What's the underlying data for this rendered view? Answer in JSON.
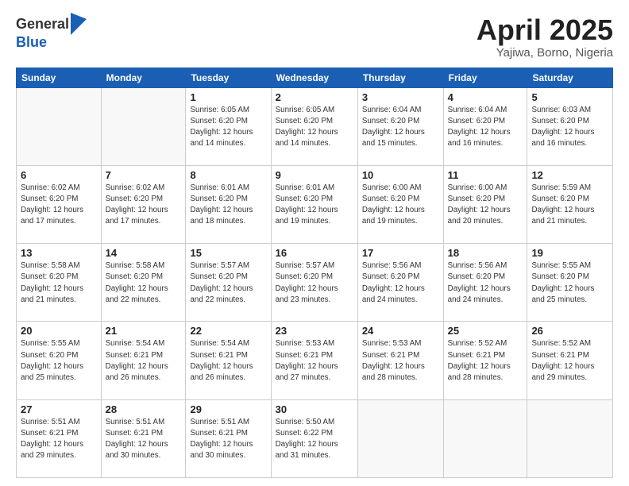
{
  "header": {
    "logo_general": "General",
    "logo_blue": "Blue",
    "title": "April 2025",
    "subtitle": "Yajiwa, Borno, Nigeria"
  },
  "weekdays": [
    "Sunday",
    "Monday",
    "Tuesday",
    "Wednesday",
    "Thursday",
    "Friday",
    "Saturday"
  ],
  "weeks": [
    [
      {
        "day": "",
        "info": ""
      },
      {
        "day": "",
        "info": ""
      },
      {
        "day": "1",
        "info": "Sunrise: 6:05 AM\nSunset: 6:20 PM\nDaylight: 12 hours\nand 14 minutes."
      },
      {
        "day": "2",
        "info": "Sunrise: 6:05 AM\nSunset: 6:20 PM\nDaylight: 12 hours\nand 14 minutes."
      },
      {
        "day": "3",
        "info": "Sunrise: 6:04 AM\nSunset: 6:20 PM\nDaylight: 12 hours\nand 15 minutes."
      },
      {
        "day": "4",
        "info": "Sunrise: 6:04 AM\nSunset: 6:20 PM\nDaylight: 12 hours\nand 16 minutes."
      },
      {
        "day": "5",
        "info": "Sunrise: 6:03 AM\nSunset: 6:20 PM\nDaylight: 12 hours\nand 16 minutes."
      }
    ],
    [
      {
        "day": "6",
        "info": "Sunrise: 6:02 AM\nSunset: 6:20 PM\nDaylight: 12 hours\nand 17 minutes."
      },
      {
        "day": "7",
        "info": "Sunrise: 6:02 AM\nSunset: 6:20 PM\nDaylight: 12 hours\nand 17 minutes."
      },
      {
        "day": "8",
        "info": "Sunrise: 6:01 AM\nSunset: 6:20 PM\nDaylight: 12 hours\nand 18 minutes."
      },
      {
        "day": "9",
        "info": "Sunrise: 6:01 AM\nSunset: 6:20 PM\nDaylight: 12 hours\nand 19 minutes."
      },
      {
        "day": "10",
        "info": "Sunrise: 6:00 AM\nSunset: 6:20 PM\nDaylight: 12 hours\nand 19 minutes."
      },
      {
        "day": "11",
        "info": "Sunrise: 6:00 AM\nSunset: 6:20 PM\nDaylight: 12 hours\nand 20 minutes."
      },
      {
        "day": "12",
        "info": "Sunrise: 5:59 AM\nSunset: 6:20 PM\nDaylight: 12 hours\nand 21 minutes."
      }
    ],
    [
      {
        "day": "13",
        "info": "Sunrise: 5:58 AM\nSunset: 6:20 PM\nDaylight: 12 hours\nand 21 minutes."
      },
      {
        "day": "14",
        "info": "Sunrise: 5:58 AM\nSunset: 6:20 PM\nDaylight: 12 hours\nand 22 minutes."
      },
      {
        "day": "15",
        "info": "Sunrise: 5:57 AM\nSunset: 6:20 PM\nDaylight: 12 hours\nand 22 minutes."
      },
      {
        "day": "16",
        "info": "Sunrise: 5:57 AM\nSunset: 6:20 PM\nDaylight: 12 hours\nand 23 minutes."
      },
      {
        "day": "17",
        "info": "Sunrise: 5:56 AM\nSunset: 6:20 PM\nDaylight: 12 hours\nand 24 minutes."
      },
      {
        "day": "18",
        "info": "Sunrise: 5:56 AM\nSunset: 6:20 PM\nDaylight: 12 hours\nand 24 minutes."
      },
      {
        "day": "19",
        "info": "Sunrise: 5:55 AM\nSunset: 6:20 PM\nDaylight: 12 hours\nand 25 minutes."
      }
    ],
    [
      {
        "day": "20",
        "info": "Sunrise: 5:55 AM\nSunset: 6:20 PM\nDaylight: 12 hours\nand 25 minutes."
      },
      {
        "day": "21",
        "info": "Sunrise: 5:54 AM\nSunset: 6:21 PM\nDaylight: 12 hours\nand 26 minutes."
      },
      {
        "day": "22",
        "info": "Sunrise: 5:54 AM\nSunset: 6:21 PM\nDaylight: 12 hours\nand 26 minutes."
      },
      {
        "day": "23",
        "info": "Sunrise: 5:53 AM\nSunset: 6:21 PM\nDaylight: 12 hours\nand 27 minutes."
      },
      {
        "day": "24",
        "info": "Sunrise: 5:53 AM\nSunset: 6:21 PM\nDaylight: 12 hours\nand 28 minutes."
      },
      {
        "day": "25",
        "info": "Sunrise: 5:52 AM\nSunset: 6:21 PM\nDaylight: 12 hours\nand 28 minutes."
      },
      {
        "day": "26",
        "info": "Sunrise: 5:52 AM\nSunset: 6:21 PM\nDaylight: 12 hours\nand 29 minutes."
      }
    ],
    [
      {
        "day": "27",
        "info": "Sunrise: 5:51 AM\nSunset: 6:21 PM\nDaylight: 12 hours\nand 29 minutes."
      },
      {
        "day": "28",
        "info": "Sunrise: 5:51 AM\nSunset: 6:21 PM\nDaylight: 12 hours\nand 30 minutes."
      },
      {
        "day": "29",
        "info": "Sunrise: 5:51 AM\nSunset: 6:21 PM\nDaylight: 12 hours\nand 30 minutes."
      },
      {
        "day": "30",
        "info": "Sunrise: 5:50 AM\nSunset: 6:22 PM\nDaylight: 12 hours\nand 31 minutes."
      },
      {
        "day": "",
        "info": ""
      },
      {
        "day": "",
        "info": ""
      },
      {
        "day": "",
        "info": ""
      }
    ]
  ]
}
